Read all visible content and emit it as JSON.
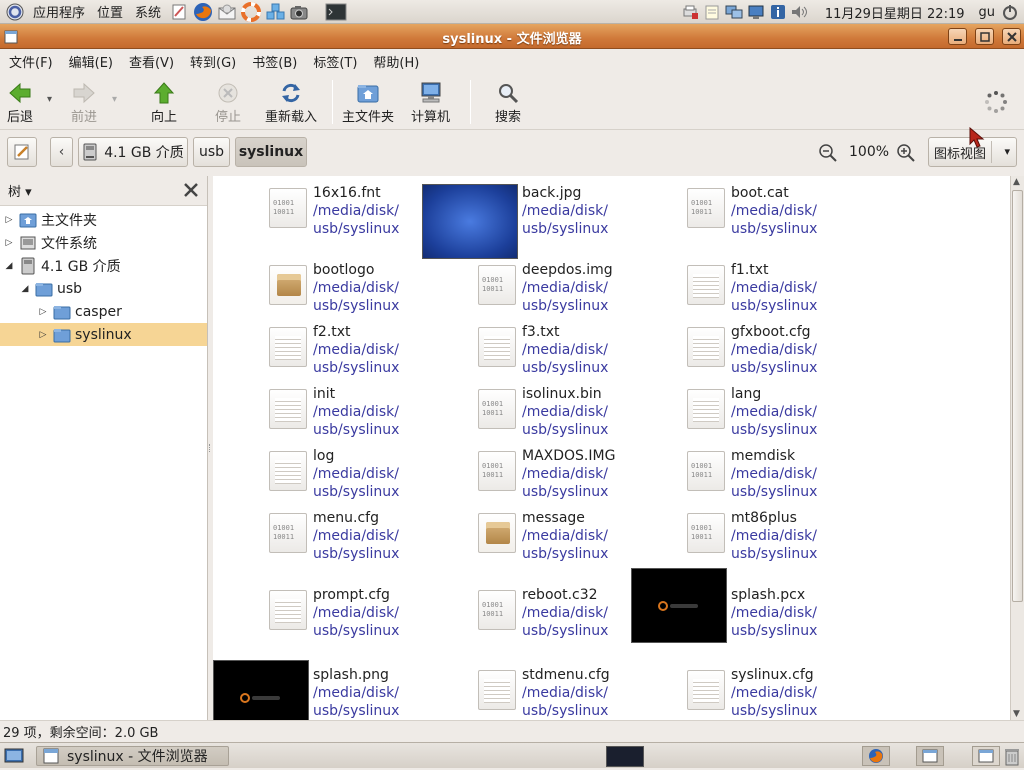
{
  "topbar": {
    "menus": [
      "应用程序",
      "位置",
      "系统"
    ],
    "clock": "11月29日星期日 22:19",
    "user": "gu"
  },
  "window": {
    "title": "syslinux - 文件浏览器"
  },
  "menubar": [
    "文件(F)",
    "编辑(E)",
    "查看(V)",
    "转到(G)",
    "书签(B)",
    "标签(T)",
    "帮助(H)"
  ],
  "toolbar": {
    "back": "后退",
    "forward": "前进",
    "up": "向上",
    "stop": "停止",
    "reload": "重新载入",
    "home": "主文件夹",
    "computer": "计算机",
    "search": "搜索"
  },
  "location": {
    "crumbs": [
      "4.1 GB 介质",
      "usb",
      "syslinux"
    ],
    "zoom": "100%",
    "view": "图标视图"
  },
  "sidebar": {
    "header": "树",
    "items": [
      {
        "label": "主文件夹",
        "level": 0,
        "expanded": false,
        "icon": "home-folder"
      },
      {
        "label": "文件系统",
        "level": 0,
        "expanded": false,
        "icon": "filesystem"
      },
      {
        "label": "4.1 GB 介质",
        "level": 0,
        "expanded": true,
        "icon": "drive"
      },
      {
        "label": "usb",
        "level": 1,
        "expanded": true,
        "icon": "folder"
      },
      {
        "label": "casper",
        "level": 2,
        "expanded": false,
        "icon": "folder"
      },
      {
        "label": "syslinux",
        "level": 2,
        "expanded": false,
        "icon": "folder",
        "selected": true
      }
    ]
  },
  "files": [
    {
      "name": "16x16.fnt",
      "path1": "/media/disk/",
      "path2": "usb/syslinux",
      "kind": "bin"
    },
    {
      "name": "back.jpg",
      "path1": "/media/disk/",
      "path2": "usb/syslinux",
      "kind": "blueimg"
    },
    {
      "name": "boot.cat",
      "path1": "/media/disk/",
      "path2": "usb/syslinux",
      "kind": "bin"
    },
    {
      "name": "bootlogo",
      "path1": "/media/disk/",
      "path2": "usb/syslinux",
      "kind": "pkg"
    },
    {
      "name": "deepdos.img",
      "path1": "/media/disk/",
      "path2": "usb/syslinux",
      "kind": "bin"
    },
    {
      "name": "f1.txt",
      "path1": "/media/disk/",
      "path2": "usb/syslinux",
      "kind": "txt"
    },
    {
      "name": "f2.txt",
      "path1": "/media/disk/",
      "path2": "usb/syslinux",
      "kind": "txt"
    },
    {
      "name": "f3.txt",
      "path1": "/media/disk/",
      "path2": "usb/syslinux",
      "kind": "txt"
    },
    {
      "name": "gfxboot.cfg",
      "path1": "/media/disk/",
      "path2": "usb/syslinux",
      "kind": "txt"
    },
    {
      "name": "init",
      "path1": "/media/disk/",
      "path2": "usb/syslinux",
      "kind": "txt"
    },
    {
      "name": "isolinux.bin",
      "path1": "/media/disk/",
      "path2": "usb/syslinux",
      "kind": "bin"
    },
    {
      "name": "lang",
      "path1": "/media/disk/",
      "path2": "usb/syslinux",
      "kind": "txt"
    },
    {
      "name": "log",
      "path1": "/media/disk/",
      "path2": "usb/syslinux",
      "kind": "txt"
    },
    {
      "name": "MAXDOS.IMG",
      "path1": "/media/disk/",
      "path2": "usb/syslinux",
      "kind": "bin"
    },
    {
      "name": "memdisk",
      "path1": "/media/disk/",
      "path2": "usb/syslinux",
      "kind": "bin"
    },
    {
      "name": "menu.cfg",
      "path1": "/media/disk/",
      "path2": "usb/syslinux",
      "kind": "bin"
    },
    {
      "name": "message",
      "path1": "/media/disk/",
      "path2": "usb/syslinux",
      "kind": "pkg"
    },
    {
      "name": "mt86plus",
      "path1": "/media/disk/",
      "path2": "usb/syslinux",
      "kind": "bin"
    },
    {
      "name": "prompt.cfg",
      "path1": "/media/disk/",
      "path2": "usb/syslinux",
      "kind": "txt"
    },
    {
      "name": "reboot.c32",
      "path1": "/media/disk/",
      "path2": "usb/syslinux",
      "kind": "bin"
    },
    {
      "name": "splash.pcx",
      "path1": "/media/disk/",
      "path2": "usb/syslinux",
      "kind": "darkimg"
    },
    {
      "name": "splash.png",
      "path1": "/media/disk/",
      "path2": "usb/syslinux",
      "kind": "darkimg"
    },
    {
      "name": "stdmenu.cfg",
      "path1": "/media/disk/",
      "path2": "usb/syslinux",
      "kind": "txt"
    },
    {
      "name": "syslinux.cfg",
      "path1": "/media/disk/",
      "path2": "usb/syslinux",
      "kind": "txt"
    }
  ],
  "status": "29 项，剩余空间：2.0 GB",
  "taskbar": {
    "task": "syslinux - 文件浏览器"
  },
  "colors": {
    "titlebar": "#d0793a",
    "selection": "#f6d595",
    "path_text": "#3a3aa0"
  }
}
